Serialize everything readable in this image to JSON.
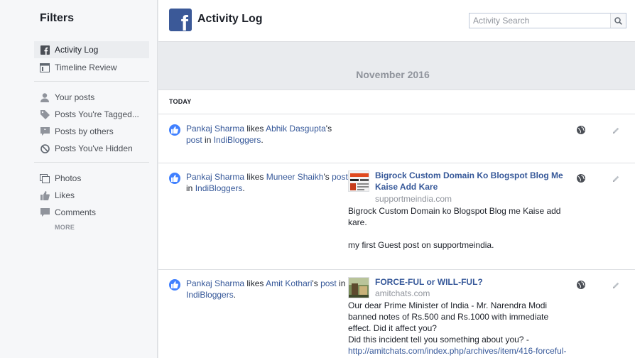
{
  "sidebar": {
    "title": "Filters",
    "items": [
      {
        "label": "Activity Log"
      },
      {
        "label": "Timeline Review"
      },
      {
        "label": "Your posts"
      },
      {
        "label": "Posts You're Tagged..."
      },
      {
        "label": "Posts by others"
      },
      {
        "label": "Posts You've Hidden"
      },
      {
        "label": "Photos"
      },
      {
        "label": "Likes"
      },
      {
        "label": "Comments"
      }
    ],
    "more": "MORE"
  },
  "header": {
    "logo": "f",
    "title": "Activity Log",
    "search_placeholder": "Activity Search"
  },
  "month": "November 2016",
  "section": "TODAY",
  "entries": [
    {
      "actor": "Pankaj Sharma",
      "verb": " likes ",
      "target": "Abhik Dasgupta",
      "possessive": "'s",
      "post": "post",
      "in_text": " in ",
      "group": "IndiBloggers",
      "end": "."
    },
    {
      "actor": "Pankaj Sharma",
      "verb": " likes ",
      "target": "Muneer Shaikh",
      "possessive": "'s",
      "post": "post",
      "in_text": " in ",
      "group": "IndiBloggers",
      "end": ".",
      "share": {
        "title": "Bigrock Custom Domain Ko Blogspot Blog Me Kaise Add Kare",
        "domain": "supportmeindia.com",
        "line1": "Bigrock Custom Domain ko Blogspot Blog me Kaise add kare.",
        "line2": "my first Guest post on supportmeindia."
      }
    },
    {
      "actor": "Pankaj Sharma",
      "verb": " likes ",
      "target": "Amit Kothari",
      "possessive": "'s",
      "post": "post",
      "in_text": " in ",
      "group": "IndiBloggers",
      "end": ".",
      "share": {
        "title": "FORCE-FUL or WILL-FUL?",
        "domain": "amitchats.com",
        "line1": "Our dear Prime Minister of India - Mr. Narendra Modi banned notes of Rs.500 and Rs.1000 with immediate effect. Did it affect you?",
        "line2": "Did this incident tell you something about you? -",
        "url": "http://amitchats.com/index.php/archives/item/416-forceful-"
      }
    }
  ],
  "colors": {
    "brand": "#3b5998",
    "link": "#365899",
    "like": "#4080ff",
    "muted": "#90949c"
  }
}
